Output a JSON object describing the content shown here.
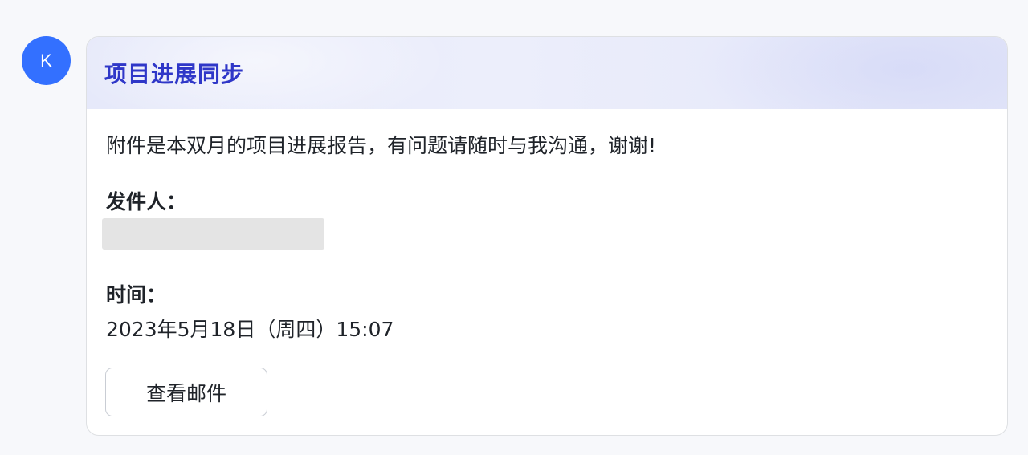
{
  "avatar": {
    "initial": "K",
    "color": "#3370ff"
  },
  "card": {
    "title": "项目进展同步",
    "message": "附件是本双月的项目进展报告，有问题请随时与我沟通，谢谢!",
    "sender_label": "发件人：",
    "time_label": "时间：",
    "time_value": "2023年5月18日（周四）15:07",
    "view_button_label": "查看邮件",
    "title_color": "#2f37c8"
  }
}
